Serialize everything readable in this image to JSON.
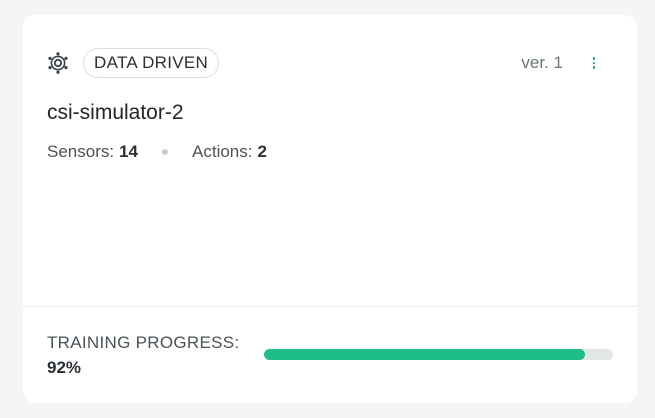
{
  "card": {
    "type_chip": "DATA DRIVEN",
    "version": "ver. 1",
    "title": "csi-simulator-2",
    "stats": {
      "sensors_label": "Sensors:",
      "sensors_value": "14",
      "actions_label": "Actions:",
      "actions_value": "2"
    },
    "training": {
      "label": "TRAINING PROGRESS:",
      "value_text": "92%",
      "progress_fraction": 0.92
    },
    "icons": {
      "model": "model-gear-icon",
      "menu": "more-vertical-icon"
    },
    "colors": {
      "accent": "#1ebc86",
      "menu_dots": "#1a9a8b"
    }
  }
}
